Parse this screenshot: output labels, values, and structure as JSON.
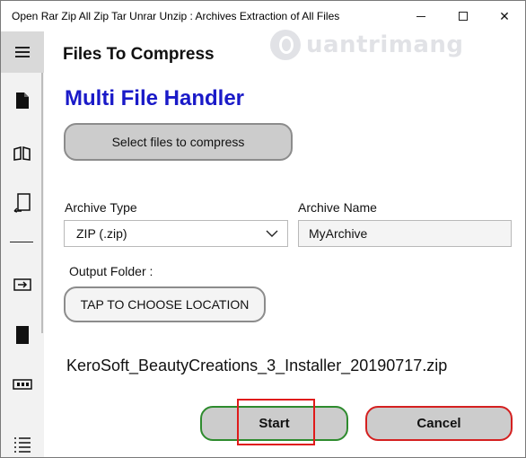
{
  "window": {
    "title": "Open Rar Zip All Zip Tar Unrar Unzip : Archives Extraction of All Files",
    "minimize_symbol": "",
    "close_symbol": "✕"
  },
  "watermark": {
    "text": "uantrimang"
  },
  "sidebar": {
    "items": [
      {
        "icon": "hamburger-menu-icon"
      },
      {
        "icon": "document-icon"
      },
      {
        "icon": "open-book-icon"
      },
      {
        "icon": "extract-document-icon"
      },
      {
        "icon": "divider"
      },
      {
        "icon": "archive-box-icon"
      },
      {
        "icon": "sd-card-icon"
      },
      {
        "icon": "tape-archive-icon"
      },
      {
        "icon": "list-icon"
      }
    ]
  },
  "header": {
    "title": "Files To Compress"
  },
  "main": {
    "title": "Multi File Handler",
    "select_button": "Select files to compress",
    "archive_type_label": "Archive Type",
    "archive_type_value": "ZIP (.zip)",
    "archive_name_label": "Archive Name",
    "archive_name_value": "MyArchive",
    "output_folder_label": "Output Folder :",
    "location_button": "TAP TO CHOOSE LOCATION",
    "filename": "KeroSoft_BeautyCreations_3_Installer_20190717.zip",
    "start_button": "Start",
    "cancel_button": "Cancel"
  },
  "colors": {
    "title_blue": "#1a1ac8",
    "start_border": "#2e8b2e",
    "cancel_border": "#d42020",
    "highlight": "#e01a1a"
  }
}
